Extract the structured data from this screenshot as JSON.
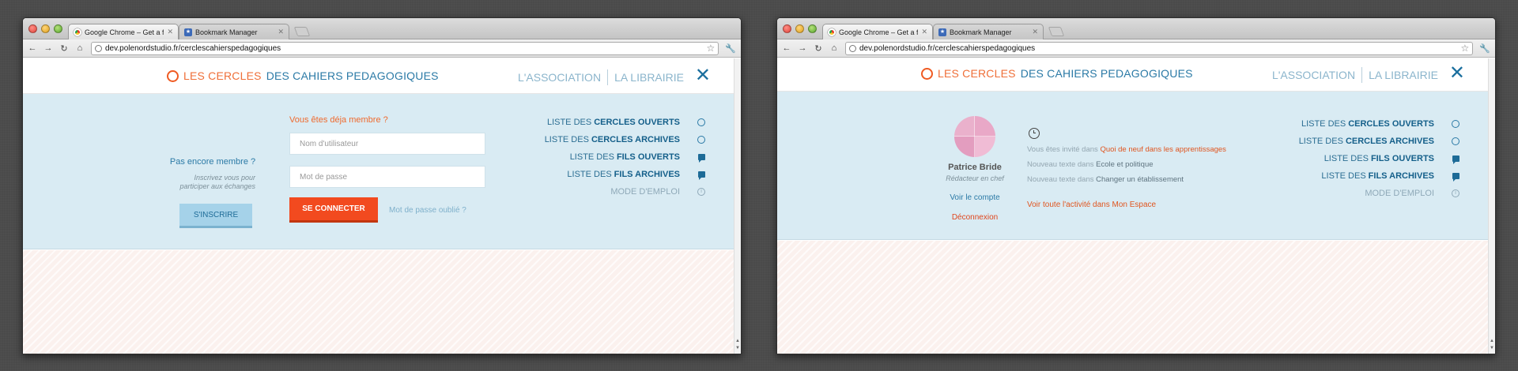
{
  "windows": [
    {
      "tabs": [
        {
          "title": "Google Chrome – Get a fast",
          "favicon": "chrome-icon"
        },
        {
          "title": "Bookmark Manager",
          "favicon": "bookmark-star-icon"
        }
      ],
      "url": "dev.polenordstudio.fr/cerclescahierspedagogiques",
      "brand": {
        "part1": "LES CERCLES",
        "part2": "DES CAHIERS PEDAGOGIQUES"
      },
      "topnav": {
        "association": "L'ASSOCIATION",
        "librairie": "LA LIBRAIRIE"
      },
      "menu": [
        {
          "prefix": "LISTE DES",
          "bold": "CERCLES OUVERTS",
          "icon": "ring-icon"
        },
        {
          "prefix": "LISTE DES",
          "bold": "CERCLES ARCHIVES",
          "icon": "ring-icon"
        },
        {
          "prefix": "LISTE DES",
          "bold": "FILS OUVERTS",
          "icon": "bubble-icon"
        },
        {
          "prefix": "LISTE DES",
          "bold": "FILS ARCHIVES",
          "icon": "bubble-icon"
        },
        {
          "prefix": "MODE D'EMPLOI",
          "bold": "",
          "icon": "info-icon"
        }
      ],
      "signup": {
        "question": "Pas encore membre ?",
        "hint_line1": "Inscrivez vous pour",
        "hint_line2": "participer aux échanges",
        "button": "S'INSCRIRE"
      },
      "login": {
        "question": "Vous êtes déja membre ?",
        "username_placeholder": "Nom d'utilisateur",
        "password_placeholder": "Mot de passe",
        "button": "SE CONNECTER",
        "forgot": "Mot de passe oublié ?"
      }
    },
    {
      "tabs": [
        {
          "title": "Google Chrome – Get a fast",
          "favicon": "chrome-icon"
        },
        {
          "title": "Bookmark Manager",
          "favicon": "bookmark-star-icon"
        }
      ],
      "url": "dev.polenordstudio.fr/cerclescahierspedagogiques",
      "brand": {
        "part1": "LES CERCLES",
        "part2": "DES CAHIERS PEDAGOGIQUES"
      },
      "topnav": {
        "association": "L'ASSOCIATION",
        "librairie": "LA LIBRAIRIE"
      },
      "menu": [
        {
          "prefix": "LISTE DES",
          "bold": "CERCLES OUVERTS",
          "icon": "ring-icon"
        },
        {
          "prefix": "LISTE DES",
          "bold": "CERCLES ARCHIVES",
          "icon": "ring-icon"
        },
        {
          "prefix": "LISTE DES",
          "bold": "FILS OUVERTS",
          "icon": "bubble-icon"
        },
        {
          "prefix": "LISTE DES",
          "bold": "FILS ARCHIVES",
          "icon": "bubble-icon"
        },
        {
          "prefix": "MODE D'EMPLOI",
          "bold": "",
          "icon": "info-icon"
        }
      ],
      "profile": {
        "name": "Patrice Bride",
        "role": "Rédacteur en chef",
        "account_link": "Voir le compte",
        "logout": "Déconnexion"
      },
      "activity": [
        {
          "text": "Vous êtes invité dans",
          "link": "Quoi de neuf dans les apprentissages"
        },
        {
          "text": "Nouveau texte dans",
          "link": "Ecole et politique"
        },
        {
          "text": "Nouveau texte dans",
          "link": "Changer un établissement"
        }
      ],
      "activity_all": "Voir toute l'activité dans Mon Espace"
    }
  ]
}
